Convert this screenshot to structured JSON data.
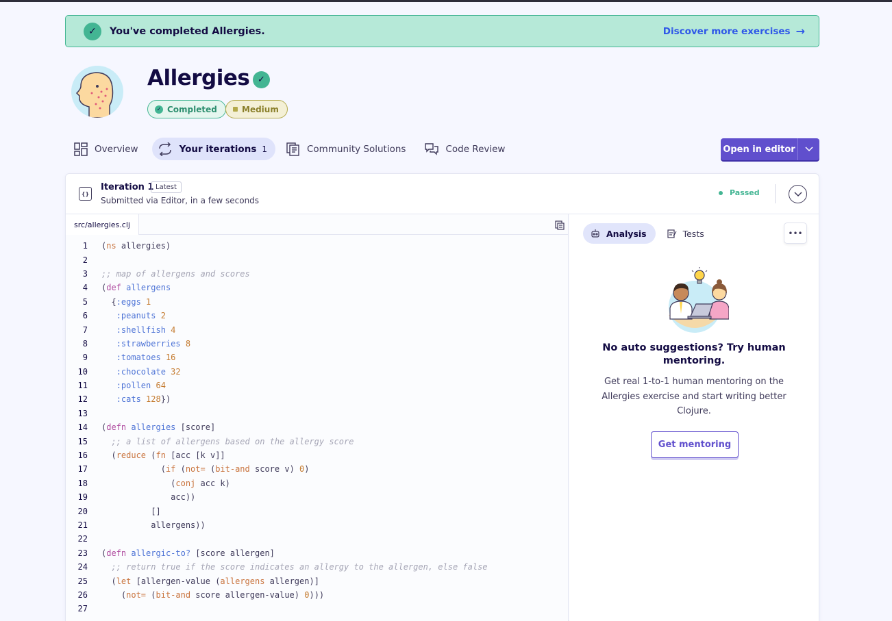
{
  "banner": {
    "message": "You've completed Allergies.",
    "link": "Discover more exercises"
  },
  "exercise": {
    "title": "Allergies",
    "status_tag": "Completed",
    "difficulty_tag": "Medium"
  },
  "tabs": [
    {
      "label": "Overview",
      "icon": "overview-icon"
    },
    {
      "label": "Your iterations",
      "count": "1",
      "icon": "iterations-icon"
    },
    {
      "label": "Community Solutions",
      "icon": "community-icon"
    },
    {
      "label": "Code Review",
      "icon": "code-review-icon"
    }
  ],
  "open_editor": "Open in editor",
  "iteration": {
    "title": "Iteration 1",
    "badge": "Latest",
    "subtitle": "Submitted via Editor, in a few seconds",
    "status": "Passed"
  },
  "file": {
    "name": "src/allergies.clj"
  },
  "code_lines": [
    "1",
    "2",
    "3",
    "4",
    "5",
    "6",
    "7",
    "8",
    "9",
    "10",
    "11",
    "12",
    "13",
    "14",
    "15",
    "16",
    "17",
    "18",
    "19",
    "20",
    "21",
    "22",
    "23",
    "24",
    "25",
    "26",
    "27"
  ],
  "side": {
    "tab_analysis": "Analysis",
    "tab_tests": "Tests",
    "more": "•••",
    "mentor_title": "No auto suggestions? Try human mentoring.",
    "mentor_text": "Get real 1-to-1 human mentoring on the Allergies exercise and start writing better Clojure.",
    "mentor_button": "Get mentoring"
  },
  "colors": {
    "accent": "#604fcd",
    "success": "#43b593",
    "banner_bg": "#b6e9d8",
    "link": "#2e57e8"
  }
}
